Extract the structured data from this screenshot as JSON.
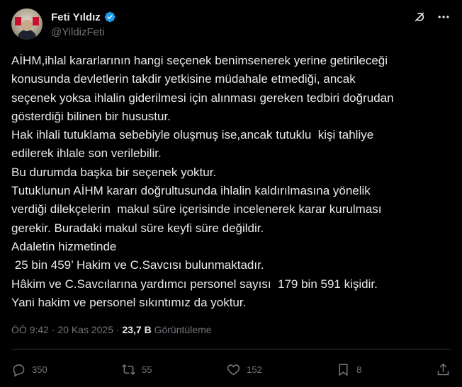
{
  "author": {
    "display_name": "Feti Yıldız",
    "handle": "@YildizFeti",
    "verified": true
  },
  "post": {
    "text": "AİHM,ihlal kararlarının hangi seçenek benimsenerek yerine getirileceği\nkonusunda devletlerin takdir yetkisine müdahale etmediği, ancak\nseçenek yoksa ihlalin giderilmesi için alınması gereken tedbiri doğrudan\ngösterdiği bilinen bir husustur.\nHak ihlali tutuklama sebebiyle oluşmuş ise,ancak tutuklu  kişi tahliye\nedilerek ihlale son verilebilir.\nBu durumda başka bir seçenek yoktur.\nTutuklunun AİHM kararı doğrultusunda ihlalin kaldırılmasına yönelik\nverdiği dilekçelerin  makul süre içerisinde incelenerek karar kurulması\ngerekir. Buradaki makul süre keyfi süre değildir.\nAdaletin hizmetinde\n 25 bin 459’ Hakim ve C.Savcısı bulunmaktadır.\nHâkim ve C.Savcılarına yardımcı personel sayısı  179 bin 591 kişidir.\nYani hakim ve personel sıkıntımız da yoktur.",
    "time": "ÖÖ 9:42",
    "separator": "·",
    "date": "20 Kas 2025",
    "views_count": "23,7 B",
    "views_label": "Görüntüleme"
  },
  "engagement": {
    "replies": "350",
    "reposts": "55",
    "likes": "152",
    "bookmarks": "8"
  },
  "icons": {
    "verified": "verified-badge-icon",
    "grok": "grok-icon",
    "more": "more-icon",
    "reply": "reply-icon",
    "repost": "repost-icon",
    "like": "heart-icon",
    "bookmark": "bookmark-icon",
    "share": "share-icon"
  },
  "colors": {
    "background": "#000000",
    "text": "#e7e9ea",
    "secondary": "#71767b",
    "verified": "#1d9bf0",
    "divider": "#2f3336"
  }
}
